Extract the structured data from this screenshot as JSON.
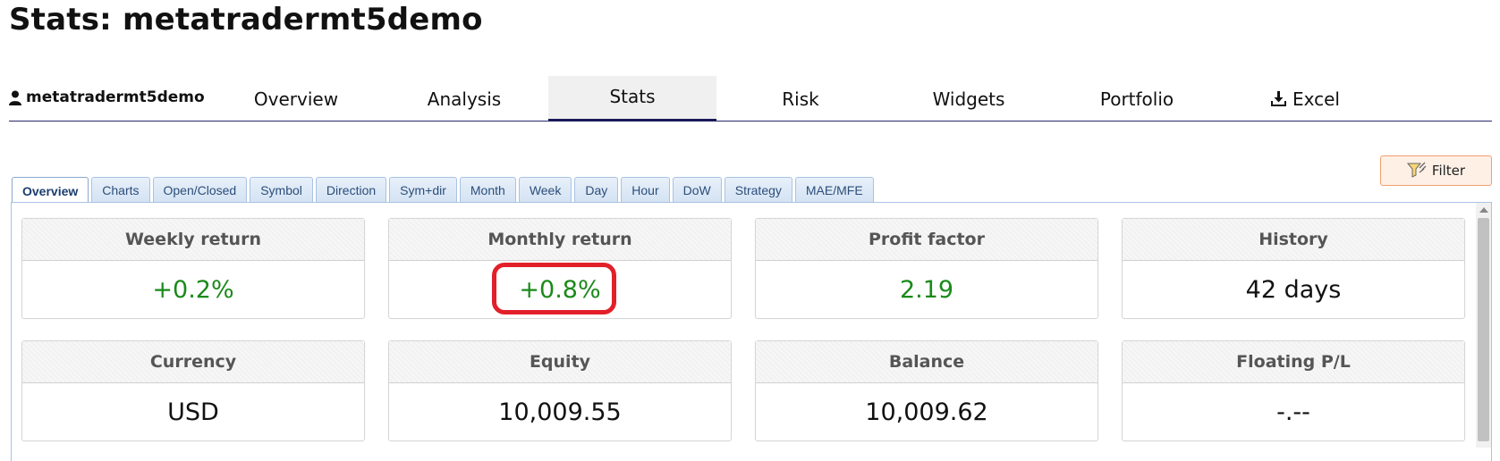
{
  "page": {
    "title": "Stats: metatradermt5demo"
  },
  "nav": {
    "account": "metatradermt5demo",
    "tabs": [
      {
        "label": "Overview"
      },
      {
        "label": "Analysis"
      },
      {
        "label": "Stats"
      },
      {
        "label": "Risk"
      },
      {
        "label": "Widgets"
      },
      {
        "label": "Portfolio"
      },
      {
        "label": "Excel"
      }
    ],
    "active_tab": "Stats"
  },
  "filter": {
    "label": "Filter"
  },
  "subtabs": {
    "items": [
      {
        "label": "Overview"
      },
      {
        "label": "Charts"
      },
      {
        "label": "Open/Closed"
      },
      {
        "label": "Symbol"
      },
      {
        "label": "Direction"
      },
      {
        "label": "Sym+dir"
      },
      {
        "label": "Month"
      },
      {
        "label": "Week"
      },
      {
        "label": "Day"
      },
      {
        "label": "Hour"
      },
      {
        "label": "DoW"
      },
      {
        "label": "Strategy"
      },
      {
        "label": "MAE/MFE"
      }
    ],
    "active": "Overview"
  },
  "stats": [
    {
      "title": "Weekly return",
      "value": "+0.2%",
      "tone": "positive"
    },
    {
      "title": "Monthly return",
      "value": "+0.8%",
      "tone": "positive",
      "highlighted": true
    },
    {
      "title": "Profit factor",
      "value": "2.19",
      "tone": "positive"
    },
    {
      "title": "History",
      "value": "42 days",
      "tone": "neutral"
    },
    {
      "title": "Currency",
      "value": "USD",
      "tone": "neutral"
    },
    {
      "title": "Equity",
      "value": "10,009.55",
      "tone": "neutral"
    },
    {
      "title": "Balance",
      "value": "10,009.62",
      "tone": "neutral"
    },
    {
      "title": "Floating P/L",
      "value": "-.--",
      "tone": "neutral"
    }
  ],
  "colors": {
    "positive": "#1a8a1a",
    "highlight": "#e2202a",
    "nav_underline": "#2a2a6a",
    "subtab_text": "#2c4e7a",
    "filter_bg": "#fff0e6"
  },
  "icons": {
    "account": "user-icon",
    "excel": "download-icon",
    "filter": "filter-icon"
  }
}
